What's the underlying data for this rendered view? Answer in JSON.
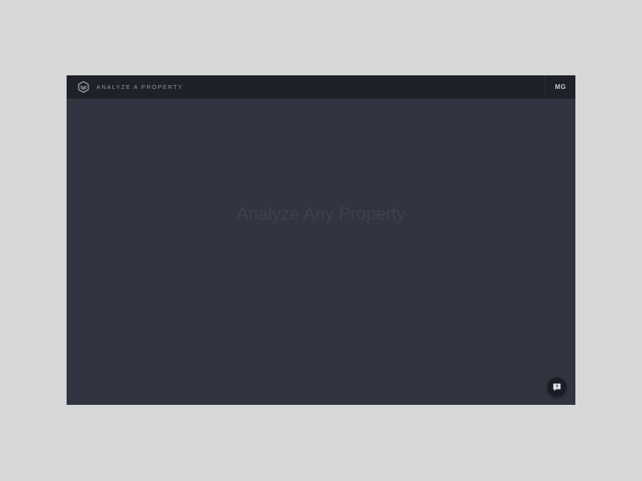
{
  "header": {
    "logo_icon": "cube-logo-icon",
    "title": "ANALYZE A PROPERTY",
    "user_initials": "MG"
  },
  "main": {
    "heading": "Analyze Any Property"
  },
  "help": {
    "icon": "chat-help-icon",
    "glyph": "?"
  },
  "colors": {
    "page_background": "#d7d7d9",
    "app_background": "#323541",
    "top_bar": "#1f2129",
    "title_text": "#8c909c",
    "heading_text": "#3d414e"
  }
}
